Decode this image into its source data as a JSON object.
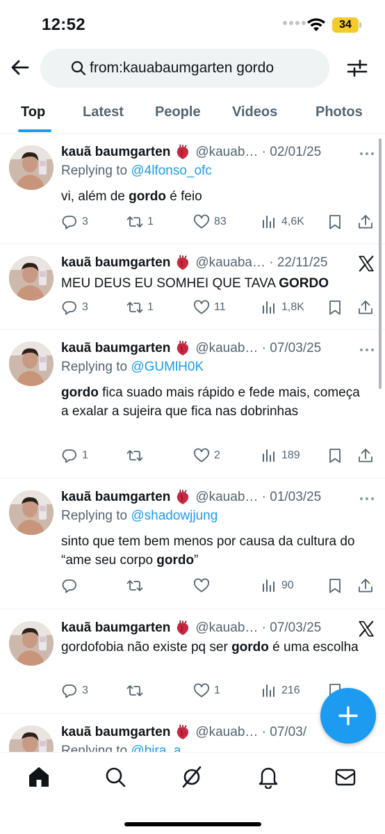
{
  "status_bar": {
    "time": "12:52",
    "battery": "34"
  },
  "search": {
    "query": "from:kauabaumgarten gordo"
  },
  "tabs": [
    {
      "label": "Top",
      "active": true
    },
    {
      "label": "Latest",
      "active": false
    },
    {
      "label": "People",
      "active": false
    },
    {
      "label": "Videos",
      "active": false
    },
    {
      "label": "Photos",
      "active": false
    }
  ],
  "tweets": [
    {
      "name": "kauã baumgarten",
      "handle_date": "@kauab… · 02/01/25",
      "replying_label": "Replying to",
      "replying_to": "@4lfonso_ofc",
      "text_parts": [
        "vi, além de ",
        "gordo",
        " é feio"
      ],
      "replies": "3",
      "retweets": "1",
      "likes": "83",
      "views": "4,6K",
      "corner": "more-icon"
    },
    {
      "name": "kauã baumgarten",
      "handle_date": "@kauaba… · 22/11/25",
      "text_parts": [
        "MEU DEUS EU SOMHEI QUE TAVA ",
        "GORDO",
        ""
      ],
      "replies": "3",
      "retweets": "1",
      "likes": "11",
      "views": "1,8K",
      "corner": "x-logo"
    },
    {
      "name": "kauã baumgarten",
      "handle_date": "@kauab… · 07/03/25",
      "replying_label": "Replying to",
      "replying_to": "@GUMlH0K",
      "text_parts": [
        "",
        "gordo",
        " fica suado mais rápido e fede mais, começa a exalar a sujeira que fica nas dobrinhas"
      ],
      "replies": "1",
      "retweets": "",
      "likes": "2",
      "views": "189",
      "corner": "more-icon"
    },
    {
      "name": "kauã baumgarten",
      "handle_date": "@kauab… · 01/03/25",
      "replying_label": "Replying to",
      "replying_to": "@shadowjjung",
      "text_parts": [
        "sinto que tem bem menos por causa da cultura do “ame seu corpo ",
        "gordo",
        "”"
      ],
      "replies": "",
      "retweets": "",
      "likes": "",
      "views": "90",
      "corner": "more-icon"
    },
    {
      "name": "kauã baumgarten",
      "handle_date": "@kauab… · 07/03/25",
      "text_parts": [
        "gordofobia não existe pq ser ",
        "gordo",
        " é uma escolha"
      ],
      "replies": "3",
      "retweets": "",
      "likes": "1",
      "views": "216",
      "corner": "x-logo"
    },
    {
      "name": "kauã baumgarten",
      "handle_date": "@kauab… · 07/03/",
      "replying_label": "Replying to",
      "replying_to": "@bira_a",
      "corner": "none"
    }
  ],
  "colors": {
    "accent": "#1d9bf0",
    "muted": "#536471",
    "battery": "#f5cb2c"
  }
}
